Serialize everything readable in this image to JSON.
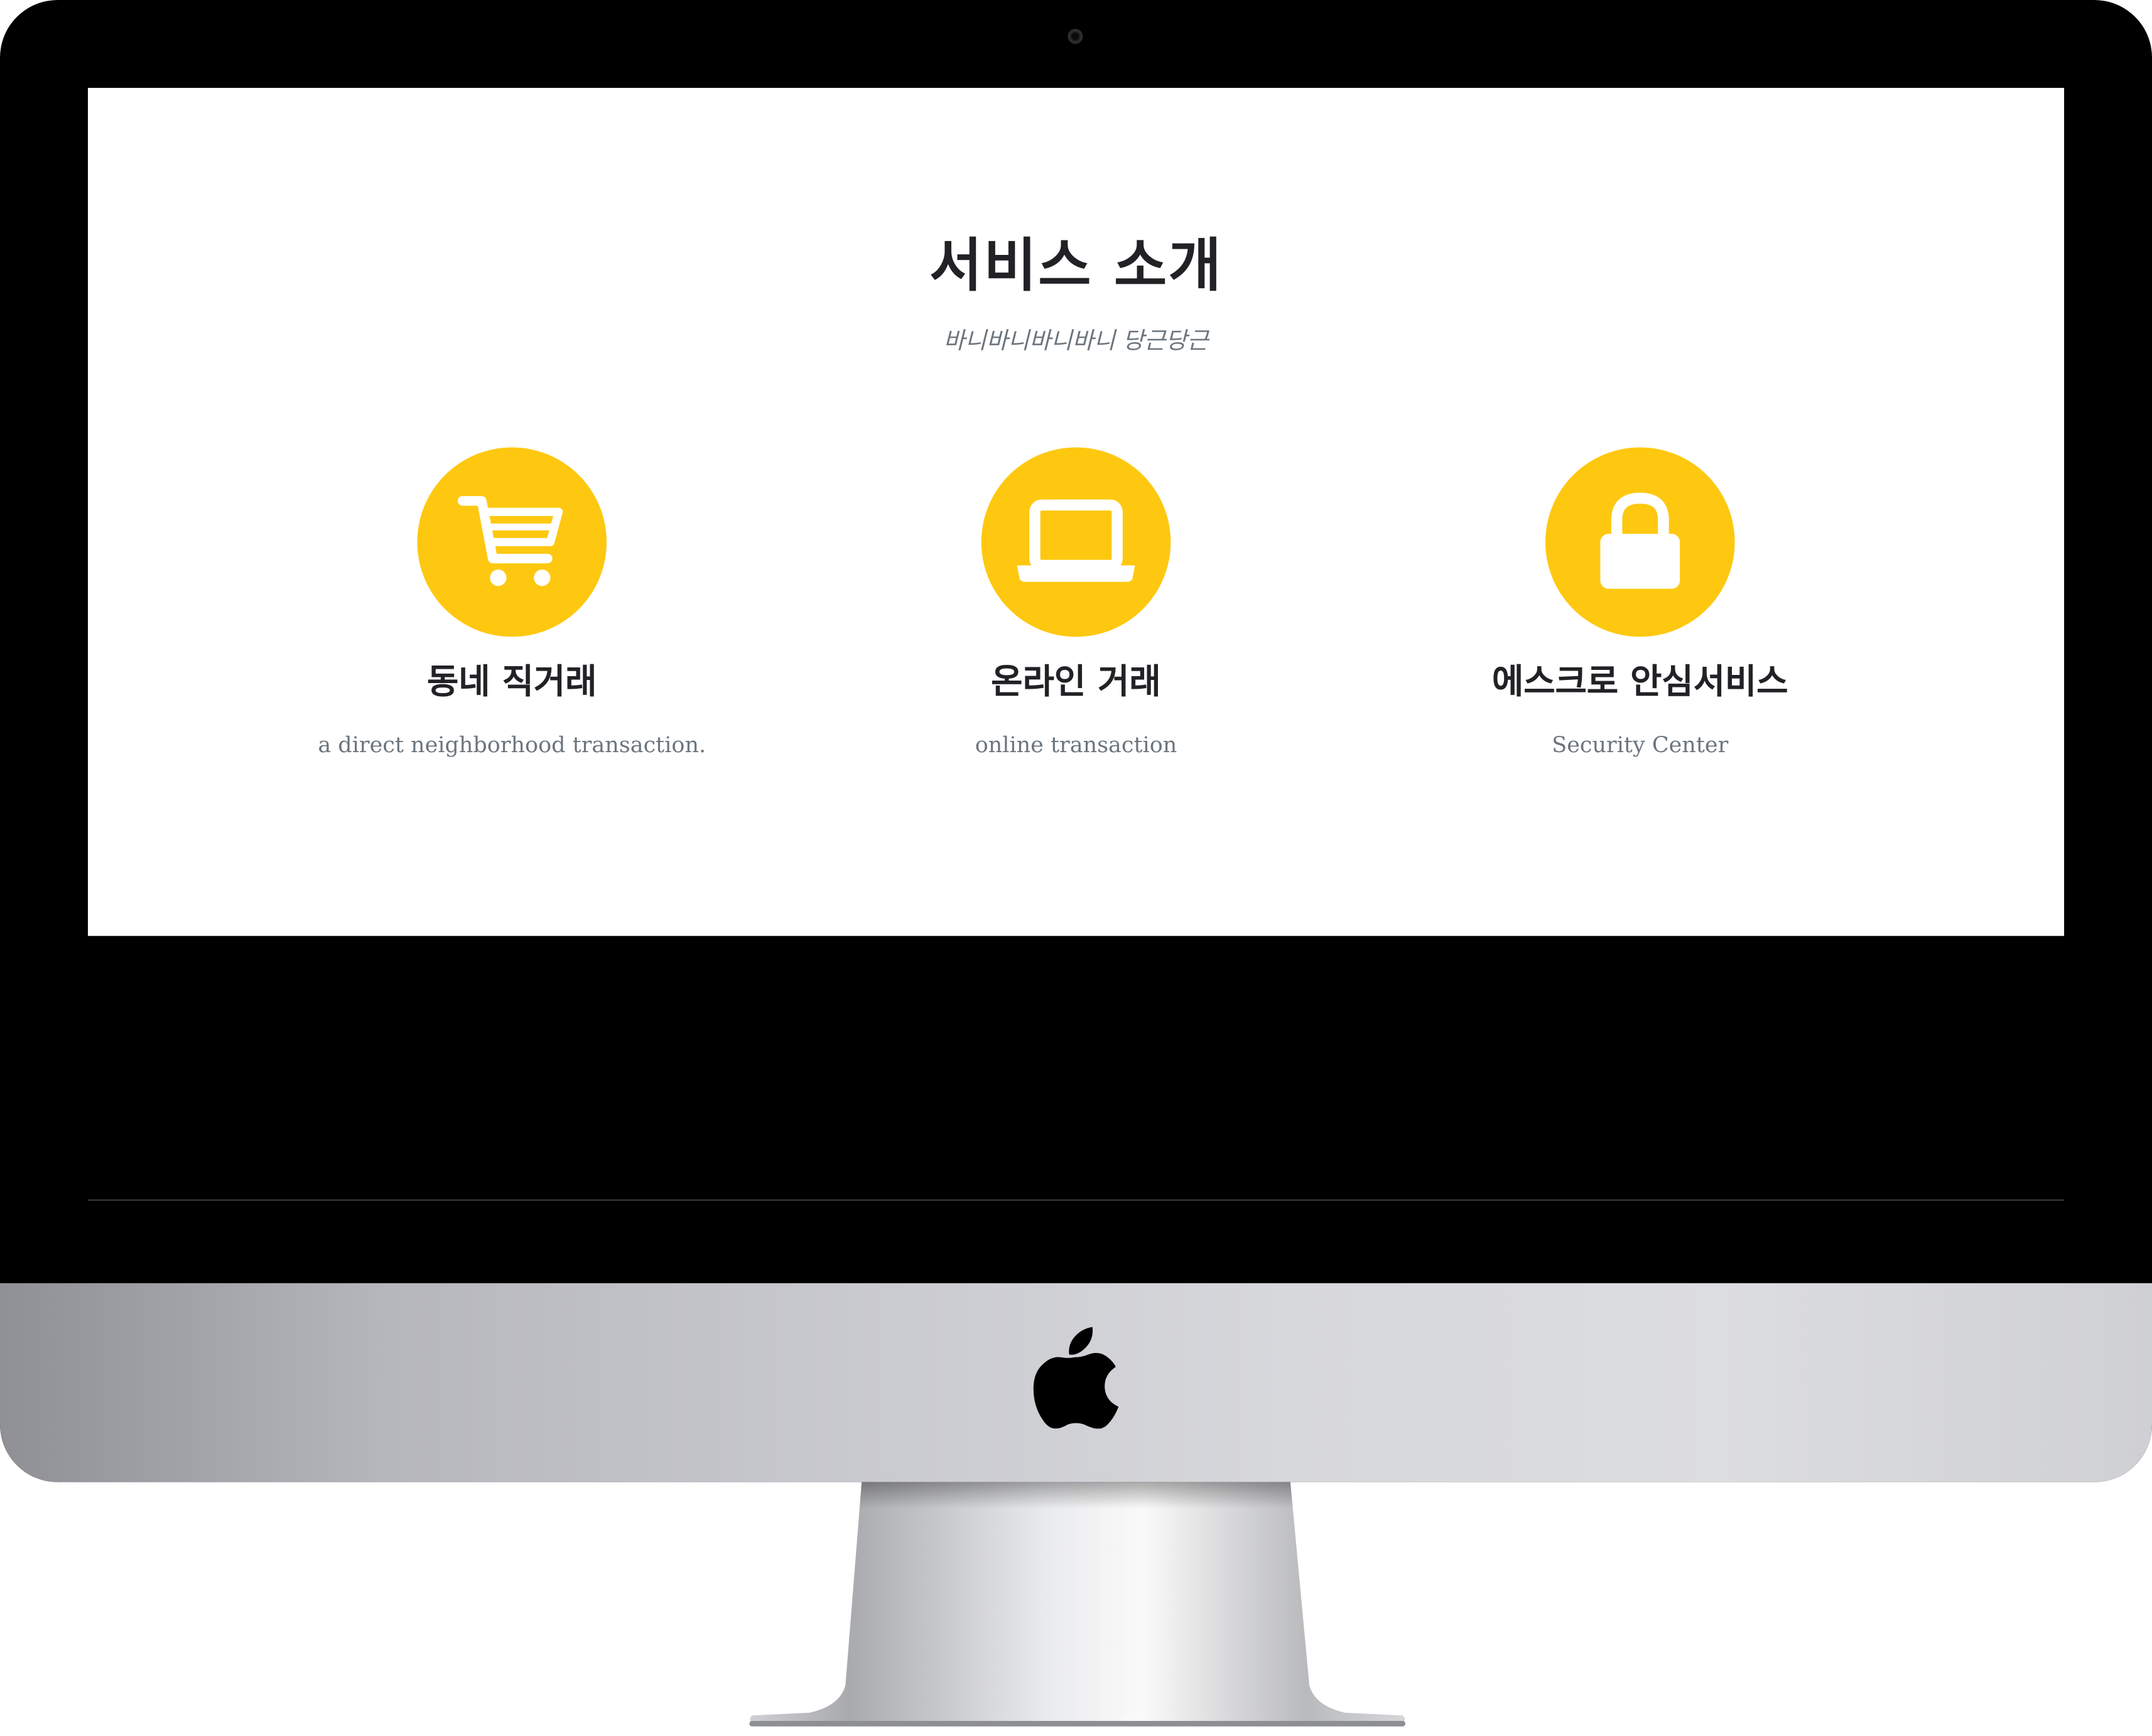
{
  "section": {
    "title": "서비스 소개",
    "subtitle": "바니바니바니바니 당근당근"
  },
  "services": [
    {
      "icon": "shopping-cart-icon",
      "title": "동네 직거래",
      "description": "a direct neighborhood transaction."
    },
    {
      "icon": "laptop-icon",
      "title": "온라인 거래",
      "description": "online transaction"
    },
    {
      "icon": "lock-icon",
      "title": "에스크로 안심서비스",
      "description": "Security Center"
    }
  ],
  "colors": {
    "accent": "#fec810",
    "heading": "#222226",
    "muted": "#6c757d",
    "screen_bg": "#ffffff",
    "bezel": "#000000"
  }
}
